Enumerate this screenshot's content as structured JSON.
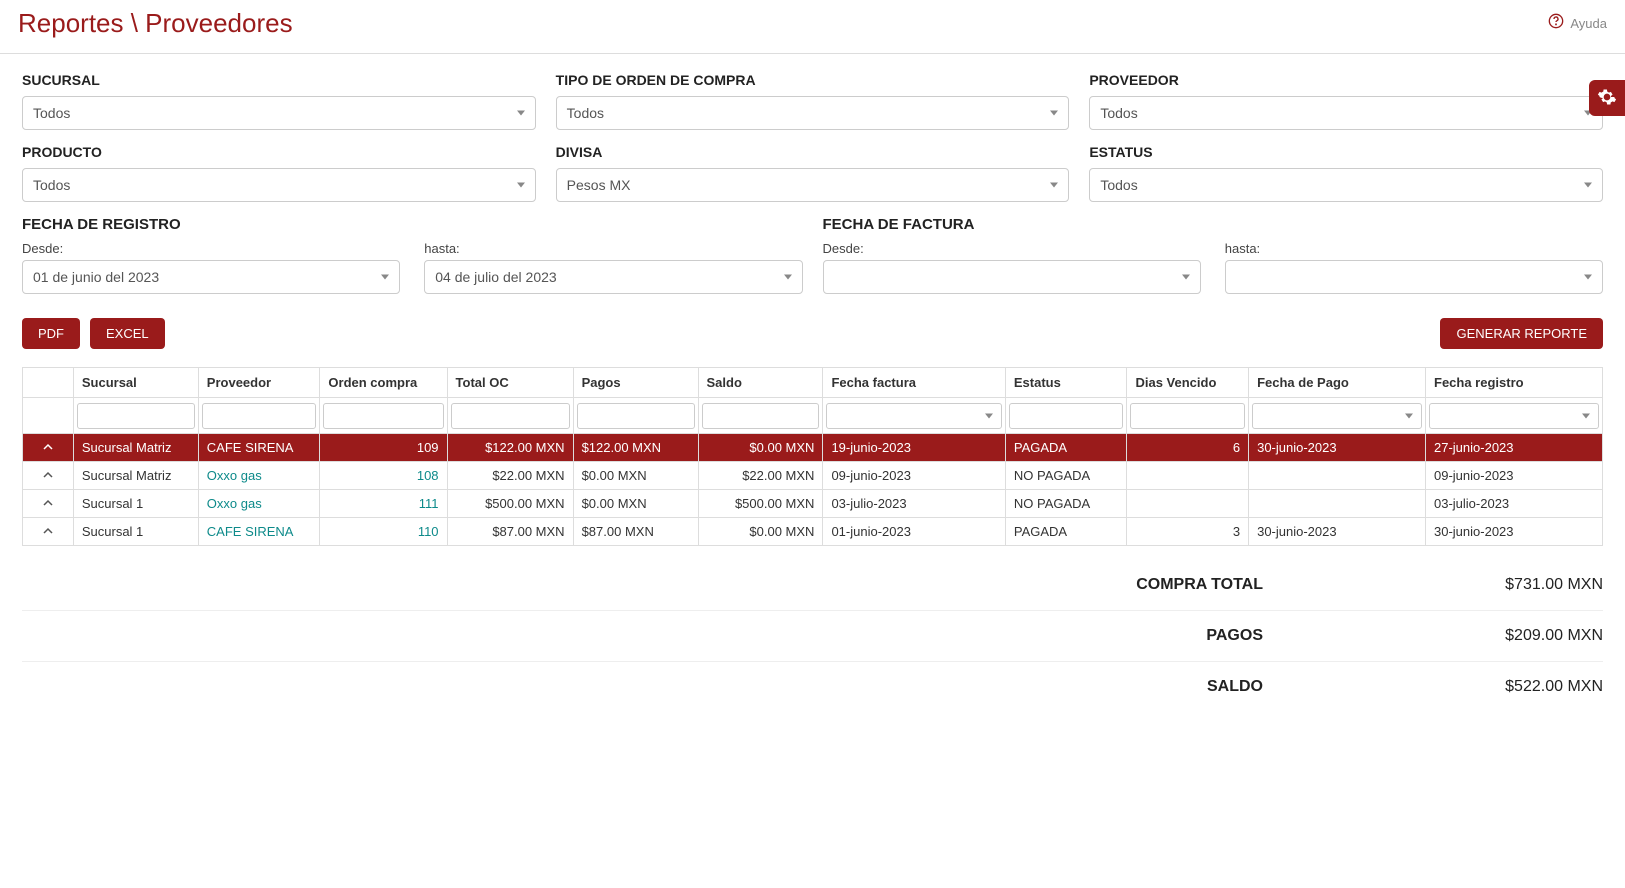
{
  "breadcrumb": "Reportes \\ Proveedores",
  "help_label": "Ayuda",
  "filters": {
    "sucursal": {
      "label": "SUCURSAL",
      "value": "Todos"
    },
    "tipo_orden": {
      "label": "TIPO DE ORDEN DE COMPRA",
      "value": "Todos"
    },
    "proveedor": {
      "label": "PROVEEDOR",
      "value": "Todos"
    },
    "producto": {
      "label": "PRODUCTO",
      "value": "Todos"
    },
    "divisa": {
      "label": "DIVISA",
      "value": "Pesos MX"
    },
    "estatus": {
      "label": "ESTATUS",
      "value": "Todos"
    }
  },
  "fecha_registro": {
    "title": "FECHA DE REGISTRO",
    "desde_label": "Desde:",
    "desde_value": "01 de junio del  2023",
    "hasta_label": "hasta:",
    "hasta_value": "04 de julio del  2023"
  },
  "fecha_factura": {
    "title": "FECHA DE FACTURA",
    "desde_label": "Desde:",
    "desde_value": "",
    "hasta_label": "hasta:",
    "hasta_value": ""
  },
  "buttons": {
    "pdf": "PDF",
    "excel": "EXCEL",
    "generar": "GENERAR REPORTE"
  },
  "table": {
    "headers": {
      "sucursal": "Sucursal",
      "proveedor": "Proveedor",
      "orden": "Orden compra",
      "total": "Total OC",
      "pagos": "Pagos",
      "saldo": "Saldo",
      "ffactura": "Fecha factura",
      "estatus": "Estatus",
      "dias": "Dias Vencido",
      "fpago": "Fecha de Pago",
      "fregistro": "Fecha registro"
    },
    "rows": [
      {
        "selected": true,
        "sucursal": "Sucursal Matriz",
        "proveedor": "CAFE SIRENA",
        "orden": "109",
        "total": "$122.00 MXN",
        "pagos": "$122.00 MXN",
        "saldo": "$0.00 MXN",
        "ffactura": "19-junio-2023",
        "estatus": "PAGADA",
        "dias": "6",
        "fpago": "30-junio-2023",
        "fregistro": "27-junio-2023"
      },
      {
        "selected": false,
        "sucursal": "Sucursal Matriz",
        "proveedor": "Oxxo gas",
        "orden": "108",
        "total": "$22.00 MXN",
        "pagos": "$0.00 MXN",
        "saldo": "$22.00 MXN",
        "ffactura": "09-junio-2023",
        "estatus": "NO PAGADA",
        "dias": "",
        "fpago": "",
        "fregistro": "09-junio-2023"
      },
      {
        "selected": false,
        "sucursal": "Sucursal 1",
        "proveedor": "Oxxo gas",
        "orden": "111",
        "total": "$500.00 MXN",
        "pagos": "$0.00 MXN",
        "saldo": "$500.00 MXN",
        "ffactura": "03-julio-2023",
        "estatus": "NO PAGADA",
        "dias": "",
        "fpago": "",
        "fregistro": "03-julio-2023"
      },
      {
        "selected": false,
        "sucursal": "Sucursal 1",
        "proveedor": "CAFE SIRENA",
        "orden": "110",
        "total": "$87.00 MXN",
        "pagos": "$87.00 MXN",
        "saldo": "$0.00 MXN",
        "ffactura": "01-junio-2023",
        "estatus": "PAGADA",
        "dias": "3",
        "fpago": "30-junio-2023",
        "fregistro": "30-junio-2023"
      }
    ]
  },
  "summary": {
    "compra_label": "COMPRA TOTAL",
    "compra_val": "$731.00 MXN",
    "pagos_label": "PAGOS",
    "pagos_val": "$209.00 MXN",
    "saldo_label": "SALDO",
    "saldo_val": "$522.00 MXN"
  }
}
